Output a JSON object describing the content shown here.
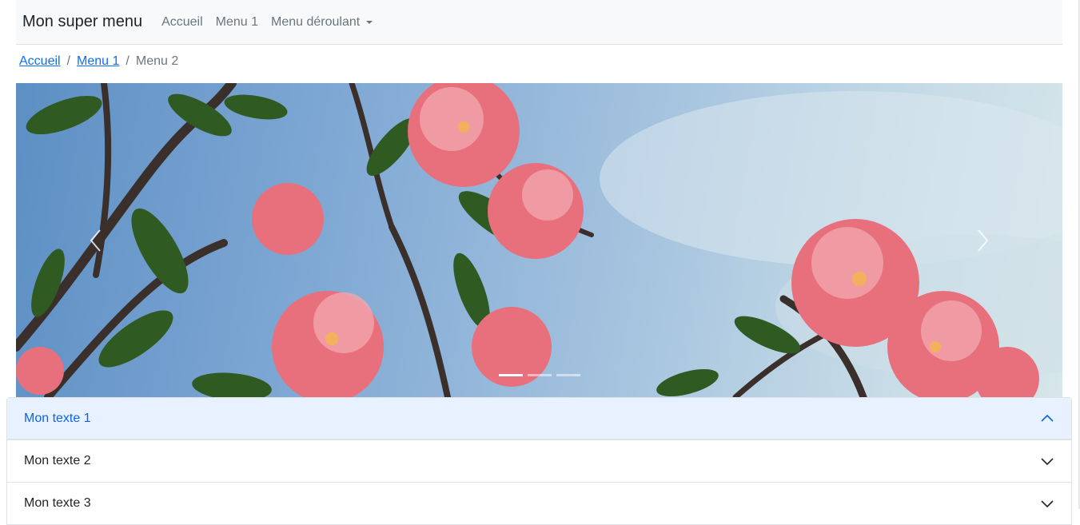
{
  "navbar": {
    "brand": "Mon super menu",
    "items": [
      {
        "label": "Accueil"
      },
      {
        "label": "Menu 1"
      },
      {
        "label": "Menu déroulant",
        "dropdown": true
      }
    ]
  },
  "breadcrumb": {
    "items": [
      {
        "label": "Accueil",
        "link": true
      },
      {
        "label": "Menu 1",
        "link": true
      },
      {
        "label": "Menu 2",
        "link": false
      }
    ],
    "separator": "/"
  },
  "carousel": {
    "slide_count": 3,
    "active_index": 0,
    "prev_icon": "chevron-left-icon",
    "next_icon": "chevron-right-icon"
  },
  "accordion": {
    "items": [
      {
        "label": "Mon texte 1",
        "expanded": true
      },
      {
        "label": "Mon texte 2",
        "expanded": false
      },
      {
        "label": "Mon texte 3",
        "expanded": false
      }
    ]
  },
  "colors": {
    "link": "#0d6efd",
    "accordion_active_bg": "#e7f1ff",
    "accordion_active_text": "#0c63e4",
    "navbar_bg": "#f8f9fa"
  }
}
